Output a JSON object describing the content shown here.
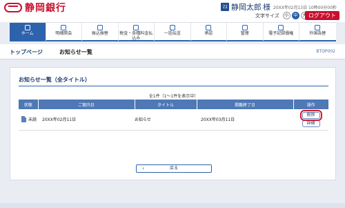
{
  "header": {
    "bank_name": "静岡銀行",
    "user_badge": "ﾏｽ",
    "user_name": "静岡太郎",
    "honorific": "様",
    "last_login": "20XX年02月13日 10時00分00秒",
    "text_size_label": "文字サイズ",
    "text_sizes": [
      "小",
      "中",
      "大"
    ],
    "logout_label": "ログアウト"
  },
  "nav": {
    "items": [
      {
        "label": "ホーム",
        "active": true
      },
      {
        "label": "明細照会"
      },
      {
        "label": "振込振替"
      },
      {
        "label": "税金・各種料金払込み"
      },
      {
        "label": "一括伝送"
      },
      {
        "label": "承認"
      },
      {
        "label": "管理"
      },
      {
        "label": "電子記録債権"
      },
      {
        "label": "外国為替"
      }
    ]
  },
  "page": {
    "breadcrumb": "トップページ",
    "title": "お知らせ一覧",
    "page_id": "BTOP002"
  },
  "card": {
    "title": "お知らせ一覧（全タイトル）",
    "result_count": "全1件（1〜1件を表示中）",
    "columns": [
      "状態",
      "ご案内日",
      "タイトル",
      "掲載終了日",
      "操作"
    ],
    "rows": [
      {
        "status": "未読",
        "date": "20XX年02月11日",
        "title": "お知らせ",
        "end_date": "20XX年03月11日",
        "delete": "削除",
        "detail": "詳細"
      }
    ],
    "back_label": "戻る"
  }
}
